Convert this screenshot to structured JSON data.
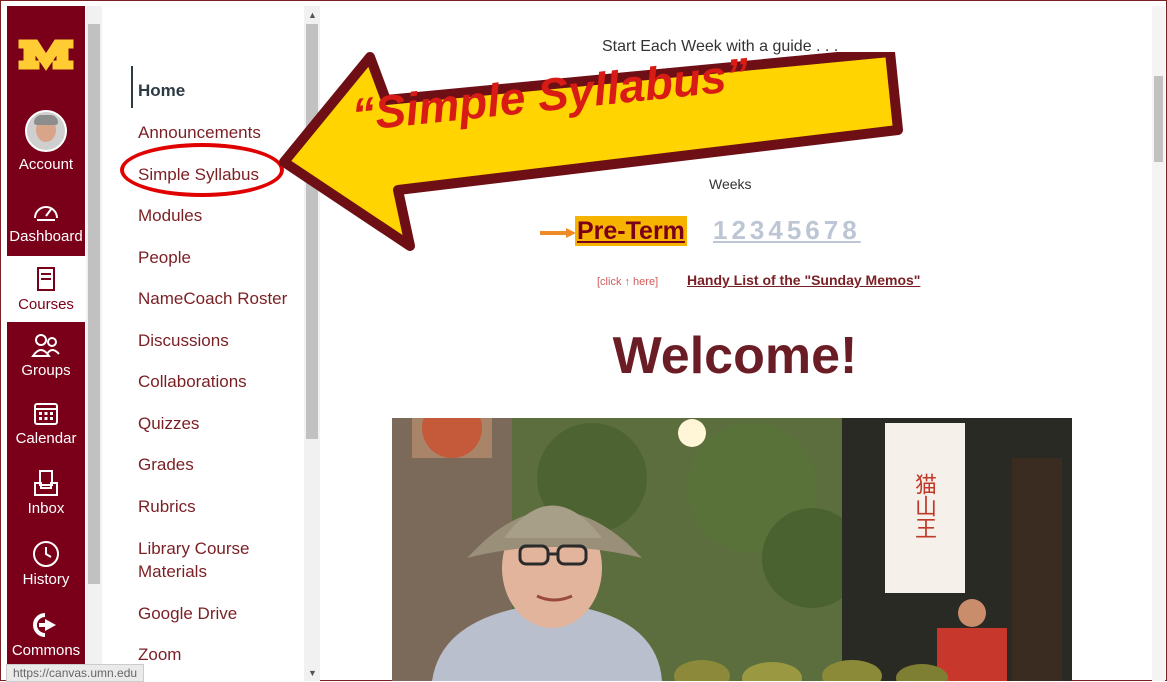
{
  "global_nav": {
    "items": [
      {
        "label": "Account",
        "icon": "avatar-icon"
      },
      {
        "label": "Dashboard",
        "icon": "dashboard-icon"
      },
      {
        "label": "Courses",
        "icon": "courses-icon"
      },
      {
        "label": "Groups",
        "icon": "groups-icon"
      },
      {
        "label": "Calendar",
        "icon": "calendar-icon"
      },
      {
        "label": "Inbox",
        "icon": "inbox-icon"
      },
      {
        "label": "History",
        "icon": "history-icon"
      },
      {
        "label": "Commons",
        "icon": "commons-icon"
      }
    ],
    "colors": {
      "background": "#7a0019",
      "logo": "#ffcc33"
    }
  },
  "course_nav": {
    "items": [
      {
        "label": "Home"
      },
      {
        "label": "Announcements"
      },
      {
        "label": "Simple Syllabus"
      },
      {
        "label": "Modules"
      },
      {
        "label": "People"
      },
      {
        "label": "NameCoach Roster"
      },
      {
        "label": "Discussions"
      },
      {
        "label": "Collaborations"
      },
      {
        "label": "Quizzes"
      },
      {
        "label": "Grades"
      },
      {
        "label": "Rubrics"
      },
      {
        "label": "Library Course Materials"
      },
      {
        "label": "Google Drive"
      },
      {
        "label": "Zoom"
      }
    ]
  },
  "annotation": {
    "text": "“Simple Syllabus”",
    "colors": {
      "fill": "#ffd400",
      "outline": "#6e0f16",
      "text": "#d81b14"
    }
  },
  "main": {
    "tagline": "Start Each Week with a guide . . .",
    "weeks_label": "Weeks",
    "pre_term": "Pre-Term",
    "week_numbers": "12345678",
    "click_here": "[click ↑ here]",
    "memos_link": "Handy List of the \"Sunday Memos\"",
    "welcome": "Welcome!",
    "photo_sign": "猫山王"
  },
  "status_bar": {
    "url": "https://canvas.umn.edu"
  }
}
